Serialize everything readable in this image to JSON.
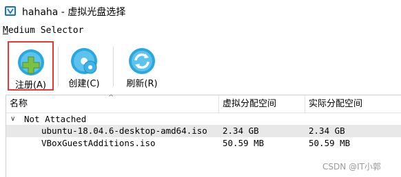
{
  "window": {
    "title": "hahaha - 虚拟光盘选择"
  },
  "selector_label": "Medium Selector",
  "toolbar": {
    "buttons": [
      {
        "label": "注册(A)",
        "icon": "register-icon"
      },
      {
        "label": "创建(C)",
        "icon": "create-icon"
      },
      {
        "label": "刷新(R)",
        "icon": "refresh-icon"
      }
    ]
  },
  "table": {
    "columns": [
      "名称",
      "虚拟分配空间",
      "实际分配空间"
    ],
    "group": "Not Attached",
    "rows": [
      {
        "name": "ubuntu-18.04.6-desktop-amd64.iso",
        "virtual": "2.34 GB",
        "actual": "2.34 GB"
      },
      {
        "name": "VBoxGuestAdditions.iso",
        "virtual": "50.59 MB",
        "actual": "50.59 MB"
      }
    ]
  },
  "watermark": "CSDN @IT小郭",
  "colors": {
    "highlight_border": "#e53935",
    "selected_row": "#e8e8e8",
    "disc_blue": "#29a8e0",
    "plus_green": "#7cc242"
  }
}
